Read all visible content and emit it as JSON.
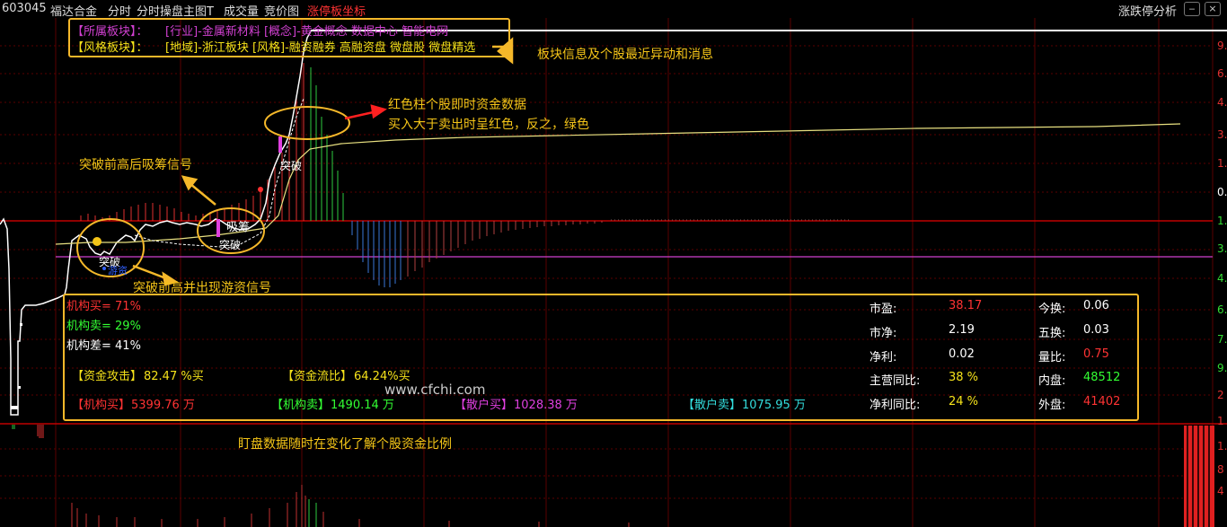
{
  "topbar": {
    "code": "603045",
    "name": "福达合金",
    "tab1": "分时",
    "tab2": "分时操盘主图T",
    "tab3": "成交量",
    "tab4": "竞价图",
    "tab5": "涨停板坐标",
    "right_label": "涨跌停分析"
  },
  "sector": {
    "line1_label": "【所属板块】：",
    "line1_value": "[行业]-金属新材料 [概念]-黄金概念 数据中心 智能电网",
    "line2_label": "【风格板块】：",
    "line2_value": "[地域]-浙江板块 [风格]-融资融券 高融资盘 微盘股 微盘精选"
  },
  "annotations": {
    "sector_info": "板块信息及个股最近异动和消息",
    "red_bar_title": "红色柱个股即时资金数据",
    "red_bar_desc": "买入大于卖出时呈红色，反之，绿色",
    "breakout_absorb": "突破前高后吸筹信号",
    "breakout_hot": "突破前高并出现游资信号",
    "bottom_note": "盯盘数据随时在变化了解个股资金比例",
    "watermark": "www.cfchi.com"
  },
  "signals": {
    "tupo": "突破",
    "xichou": "吸筹",
    "youzi": "游资"
  },
  "institution": {
    "buy": "机构买= 71%",
    "sell": "机构卖= 29%",
    "diff": "机构差= 41%",
    "attack_label": "【资金攻击】",
    "attack_value": "82.47 %买",
    "flow_label": "【资金流比】",
    "flow_value": "64.24%买",
    "inst_buy_label": "【机构买】",
    "inst_buy_value": "5399.76 万",
    "inst_sell_label": "【机构卖】",
    "inst_sell_value": "1490.14 万",
    "retail_buy_label": "【散户买】",
    "retail_buy_value": "1028.38 万",
    "retail_sell_label": "【散户卖】",
    "retail_sell_value": "1075.95 万"
  },
  "stats": [
    {
      "label": "市盈:",
      "value": "38.17",
      "color": "#ff3333"
    },
    {
      "label": "市净:",
      "value": "2.19",
      "color": "#ffffff"
    },
    {
      "label": "净利:",
      "value": "0.02",
      "color": "#ffffff"
    },
    {
      "label": "主营同比:",
      "value": "38 %",
      "color": "#f5e21a"
    },
    {
      "label": "净利同比:",
      "value": "24 %",
      "color": "#f5e21a"
    }
  ],
  "stats2": [
    {
      "label": "今换:",
      "value": "0.06",
      "color": "#ffffff"
    },
    {
      "label": "五换:",
      "value": "0.03",
      "color": "#ffffff"
    },
    {
      "label": "量比:",
      "value": "0.75",
      "color": "#ff3333"
    },
    {
      "label": "内盘:",
      "value": "48512",
      "color": "#33ff33"
    },
    {
      "label": "外盘:",
      "value": "41402",
      "color": "#ff3333"
    }
  ],
  "axis_right": [
    "9.",
    "6.",
    "4.",
    "3.",
    "1.",
    "0.",
    "1.",
    "3.",
    "4.",
    "6.",
    "7.",
    "9.",
    "2",
    "1",
    "1.",
    "8",
    "4"
  ]
}
